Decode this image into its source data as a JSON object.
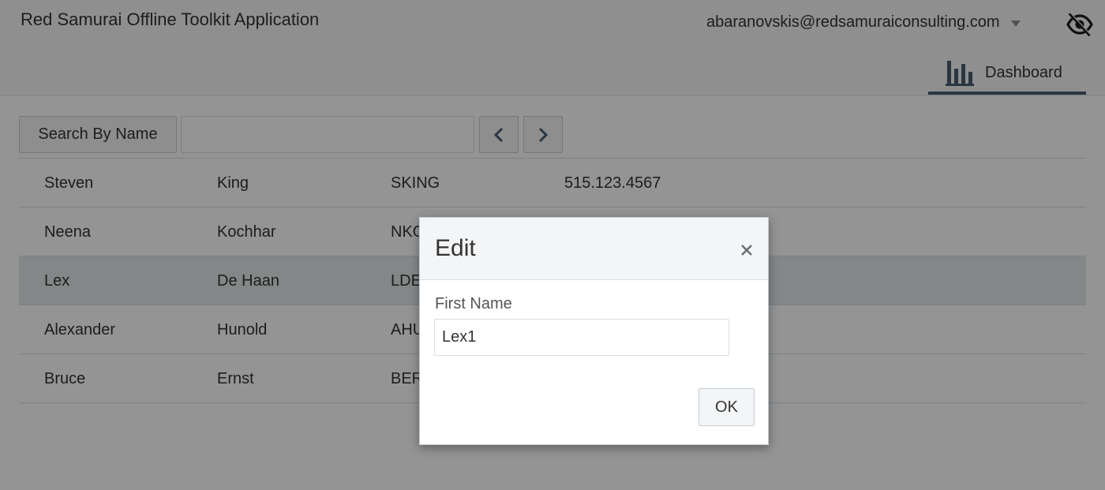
{
  "app": {
    "title": "Red Samurai Offline Toolkit Application",
    "user_email": "abaranovskis@redsamuraiconsulting.com"
  },
  "icons": {
    "user_menu": "chevron-down-icon",
    "visibility": "eye-off-icon",
    "dashboard": "bar-chart-icon",
    "previous": "chevron-left-icon",
    "next": "chevron-right-icon",
    "close": "close-icon"
  },
  "nav": {
    "dashboard_label": "Dashboard"
  },
  "toolbar": {
    "search_button_label": "Search By Name",
    "search_value": ""
  },
  "employees": [
    {
      "first": "Steven",
      "last": "King",
      "email": "SKING",
      "phone": "515.123.4567"
    },
    {
      "first": "Neena",
      "last": "Kochhar",
      "email": "NKO",
      "phone": ""
    },
    {
      "first": "Lex",
      "last": "De Haan",
      "email": "LDE",
      "phone": ""
    },
    {
      "first": "Alexander",
      "last": "Hunold",
      "email": "AHU",
      "phone": ""
    },
    {
      "first": "Bruce",
      "last": "Ernst",
      "email": "BER",
      "phone": ""
    }
  ],
  "dialog": {
    "title": "Edit",
    "field_label": "First Name",
    "field_value": "Lex1",
    "ok_label": "OK"
  },
  "colors": {
    "overlay": "rgba(0,0,0,0.42)",
    "nav_underline": "#4a5d70",
    "selected_row": "#e4e8ea"
  }
}
